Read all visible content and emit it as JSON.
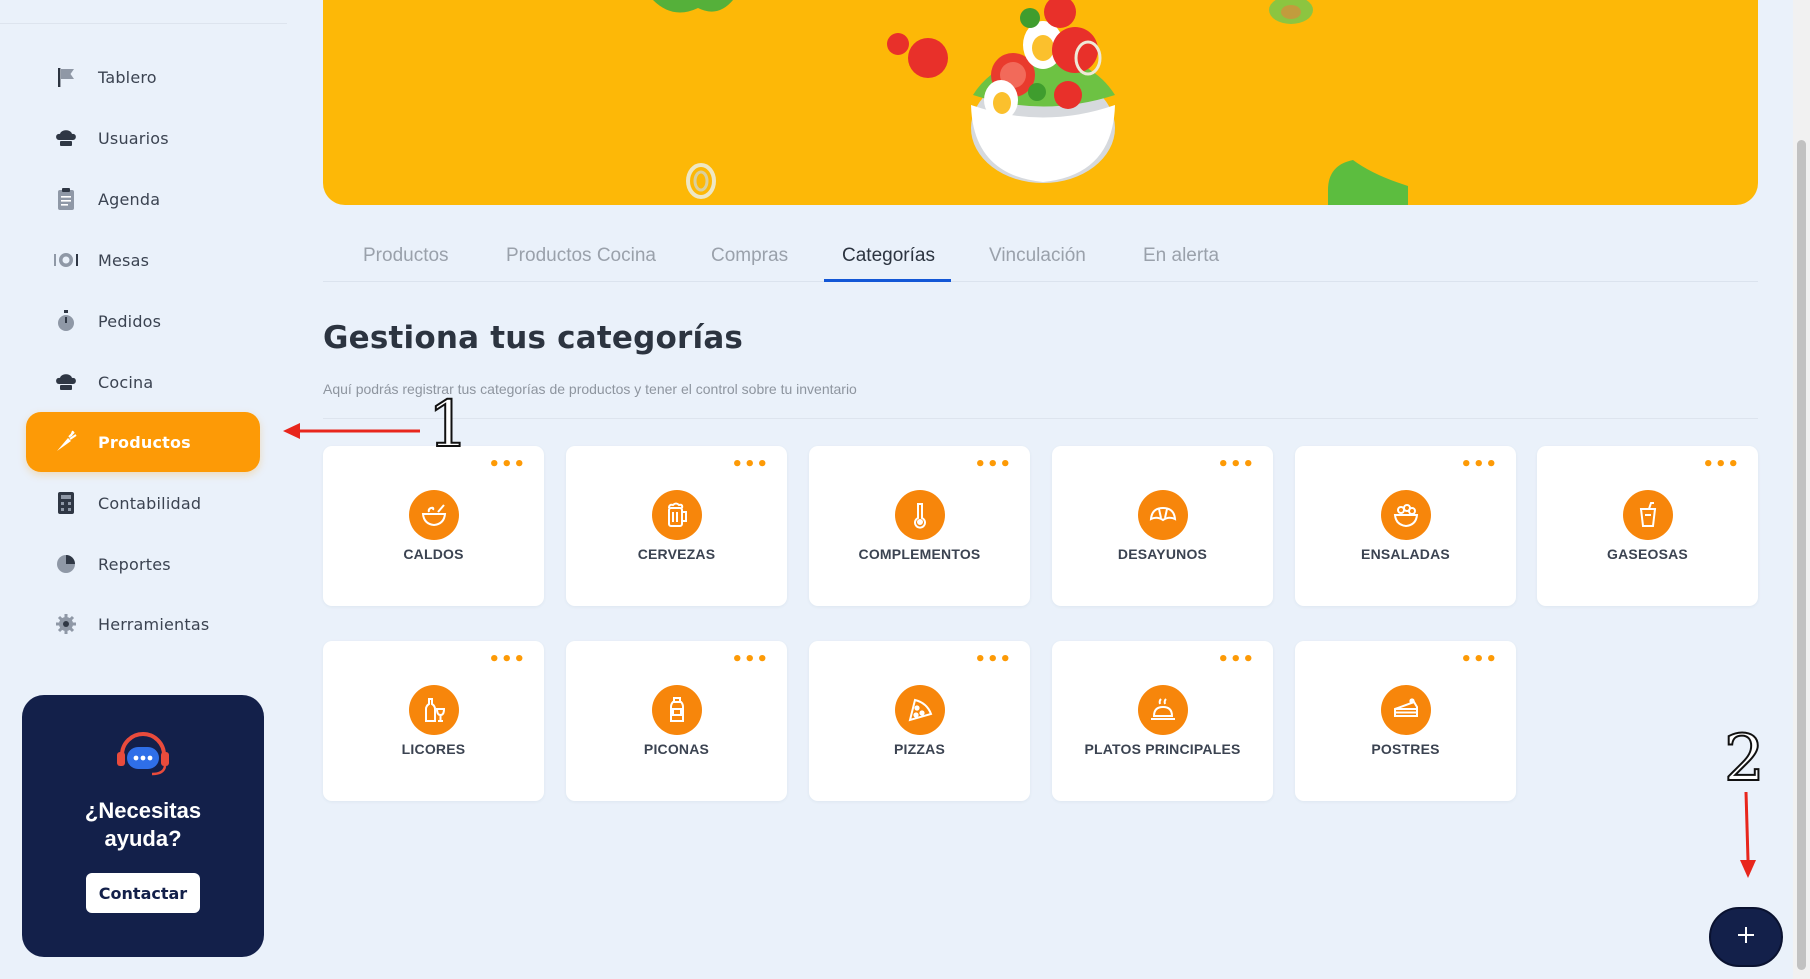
{
  "sidebar": {
    "items": [
      {
        "label": "Tablero",
        "icon": "flag-icon"
      },
      {
        "label": "Usuarios",
        "icon": "chef-hat-icon"
      },
      {
        "label": "Agenda",
        "icon": "clipboard-icon"
      },
      {
        "label": "Mesas",
        "icon": "plate-cutlery-icon"
      },
      {
        "label": "Pedidos",
        "icon": "stopwatch-icon"
      },
      {
        "label": "Cocina",
        "icon": "chef-hat-icon"
      },
      {
        "label": "Productos",
        "icon": "carrot-icon",
        "active": true
      },
      {
        "label": "Contabilidad",
        "icon": "calculator-icon"
      },
      {
        "label": "Reportes",
        "icon": "pie-chart-icon"
      },
      {
        "label": "Herramientas",
        "icon": "gear-icon"
      }
    ],
    "help": {
      "title": "¿Necesitas ayuda?",
      "button": "Contactar",
      "icon": "headset-icon"
    }
  },
  "tabs": [
    {
      "label": "Productos"
    },
    {
      "label": "Productos Cocina"
    },
    {
      "label": "Compras"
    },
    {
      "label": "Categorías",
      "active": true
    },
    {
      "label": "Vinculación"
    },
    {
      "label": "En alerta"
    }
  ],
  "page": {
    "title": "Gestiona tus categorías",
    "subtitle": "Aquí podrás registrar tus categorías de productos y tener el control sobre tu inventario"
  },
  "categories": [
    {
      "label": "CALDOS",
      "icon": "soup-bowl-icon"
    },
    {
      "label": "CERVEZAS",
      "icon": "beer-mug-icon"
    },
    {
      "label": "COMPLEMENTOS",
      "icon": "thermometer-icon"
    },
    {
      "label": "DESAYUNOS",
      "icon": "croissant-icon"
    },
    {
      "label": "ENSALADAS",
      "icon": "salad-bowl-icon"
    },
    {
      "label": "GASEOSAS",
      "icon": "soda-cup-icon"
    },
    {
      "label": "LICORES",
      "icon": "liquor-bottle-icon"
    },
    {
      "label": "PICONAS",
      "icon": "bottle-icon"
    },
    {
      "label": "PIZZAS",
      "icon": "pizza-slice-icon"
    },
    {
      "label": "PLATOS PRINCIPALES",
      "icon": "roast-chicken-icon"
    },
    {
      "label": "POSTRES",
      "icon": "cake-slice-icon"
    }
  ],
  "card_menu": "•••",
  "fab": {
    "label": "+",
    "icon": "plus-icon"
  },
  "annotations": {
    "step1": "1",
    "step2": "2"
  },
  "colors": {
    "accent": "#fd9a06",
    "icon_bg": "#f7860b",
    "navy": "#13204a",
    "banner": "#fdb807",
    "tab_indicator": "#1357d6",
    "annotation_arrow": "#e8261c"
  }
}
